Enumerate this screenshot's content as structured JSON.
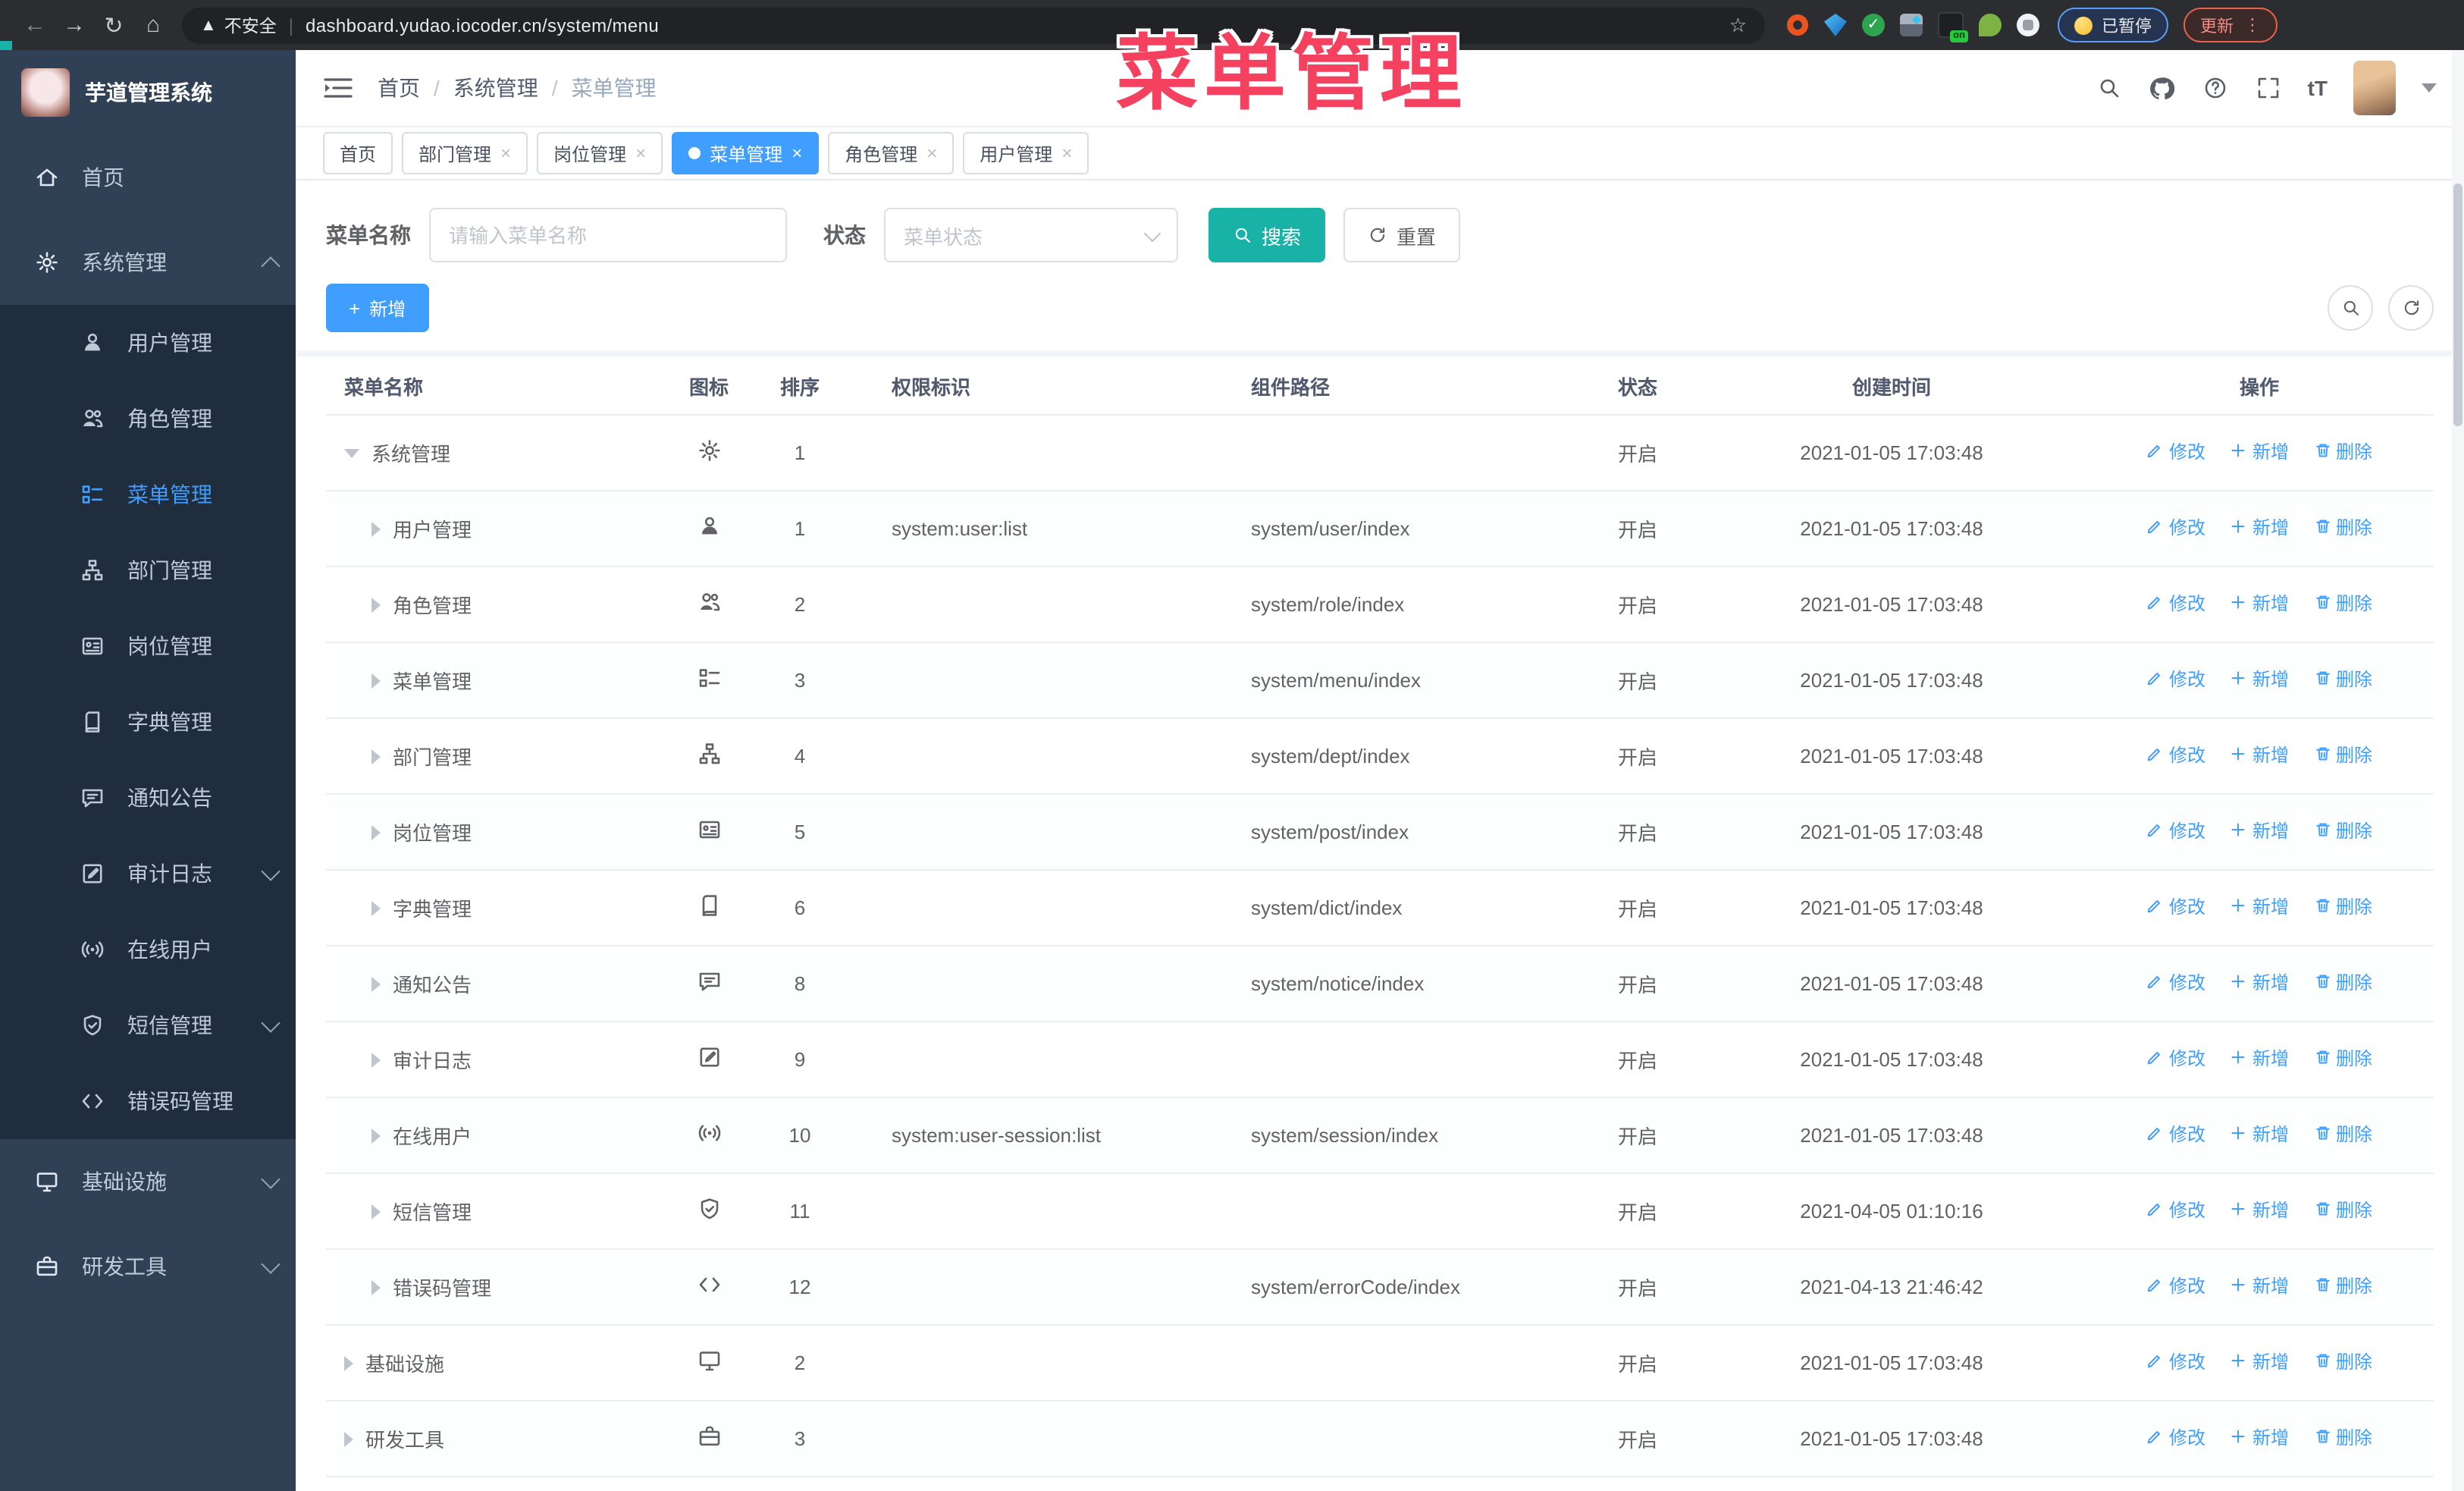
{
  "overlay_title": "菜单管理",
  "colors": {
    "accent": "#409eff",
    "teal": "#18b3a6",
    "pink": "#f4415f",
    "sidebar_bg": "#304156",
    "submenu_bg": "#1f2d3d"
  },
  "browser": {
    "security_label": "不安全",
    "url": "dashboard.yudao.iocoder.cn/system/menu",
    "paused_badge": "已暂停",
    "update_button": "更新",
    "extensions": [
      {
        "icon": "ubuntu-ring"
      },
      {
        "icon": "blue-gem"
      },
      {
        "icon": "green-check"
      },
      {
        "icon": "grid-widget"
      },
      {
        "icon": "monitor-ext",
        "badge": "on"
      },
      {
        "icon": "leaf-ext"
      },
      {
        "icon": "puzzle-ext"
      }
    ]
  },
  "sidebar": {
    "logo_title": "芋道管理系统",
    "entries": [
      {
        "id": "home",
        "label": "首页",
        "icon": "home",
        "type": "root"
      },
      {
        "id": "system",
        "label": "系统管理",
        "icon": "gear",
        "type": "root",
        "arrow": "up"
      },
      {
        "id": "user",
        "label": "用户管理",
        "icon": "user",
        "type": "sub"
      },
      {
        "id": "role",
        "label": "角色管理",
        "icon": "users",
        "type": "sub"
      },
      {
        "id": "menu",
        "label": "菜单管理",
        "icon": "menu",
        "type": "sub",
        "active": true
      },
      {
        "id": "dept",
        "label": "部门管理",
        "icon": "tree",
        "type": "sub"
      },
      {
        "id": "post",
        "label": "岗位管理",
        "icon": "postcard",
        "type": "sub"
      },
      {
        "id": "dict",
        "label": "字典管理",
        "icon": "dict",
        "type": "sub"
      },
      {
        "id": "notice",
        "label": "通知公告",
        "icon": "notice",
        "type": "sub"
      },
      {
        "id": "audit",
        "label": "审计日志",
        "icon": "audit",
        "type": "sub",
        "arrow": "down"
      },
      {
        "id": "online",
        "label": "在线用户",
        "icon": "online",
        "type": "sub"
      },
      {
        "id": "sms",
        "label": "短信管理",
        "icon": "sms",
        "type": "sub",
        "arrow": "down"
      },
      {
        "id": "errorcode",
        "label": "错误码管理",
        "icon": "code",
        "type": "sub"
      },
      {
        "id": "infra",
        "label": "基础设施",
        "icon": "infra",
        "type": "root",
        "arrow": "down"
      },
      {
        "id": "devtool",
        "label": "研发工具",
        "icon": "tool",
        "type": "root",
        "arrow": "down"
      }
    ]
  },
  "header": {
    "breadcrumb": [
      "首页",
      "系统管理",
      "菜单管理"
    ]
  },
  "tabs": [
    {
      "label": "首页"
    },
    {
      "label": "部门管理",
      "closable": true
    },
    {
      "label": "岗位管理",
      "closable": true
    },
    {
      "label": "菜单管理",
      "closable": true,
      "active": true
    },
    {
      "label": "角色管理",
      "closable": true
    },
    {
      "label": "用户管理",
      "closable": true
    }
  ],
  "search": {
    "name_label": "菜单名称",
    "name_placeholder": "请输入菜单名称",
    "status_label": "状态",
    "status_placeholder": "菜单状态",
    "search_button": "搜索",
    "reset_button": "重置"
  },
  "toolbar": {
    "add_button": "新增"
  },
  "table": {
    "columns": [
      "菜单名称",
      "图标",
      "排序",
      "权限标识",
      "组件路径",
      "状态",
      "创建时间",
      "操作"
    ],
    "action_labels": {
      "edit": "修改",
      "add": "新增",
      "del": "删除"
    },
    "rows": [
      {
        "level": 0,
        "caret": "down",
        "name": "系统管理",
        "icon": "gear",
        "sort": "1",
        "perm": "",
        "path": "",
        "status": "开启",
        "time": "2021-01-05 17:03:48"
      },
      {
        "level": 1,
        "caret": "right",
        "name": "用户管理",
        "icon": "user",
        "sort": "1",
        "perm": "system:user:list",
        "path": "system/user/index",
        "status": "开启",
        "time": "2021-01-05 17:03:48"
      },
      {
        "level": 1,
        "caret": "right",
        "name": "角色管理",
        "icon": "users",
        "sort": "2",
        "perm": "",
        "path": "system/role/index",
        "status": "开启",
        "time": "2021-01-05 17:03:48"
      },
      {
        "level": 1,
        "caret": "right",
        "name": "菜单管理",
        "icon": "menu",
        "sort": "3",
        "perm": "",
        "path": "system/menu/index",
        "status": "开启",
        "time": "2021-01-05 17:03:48"
      },
      {
        "level": 1,
        "caret": "right",
        "name": "部门管理",
        "icon": "tree",
        "sort": "4",
        "perm": "",
        "path": "system/dept/index",
        "status": "开启",
        "time": "2021-01-05 17:03:48"
      },
      {
        "level": 1,
        "caret": "right",
        "name": "岗位管理",
        "icon": "postcard",
        "sort": "5",
        "perm": "",
        "path": "system/post/index",
        "status": "开启",
        "time": "2021-01-05 17:03:48"
      },
      {
        "level": 1,
        "caret": "right",
        "name": "字典管理",
        "icon": "dict",
        "sort": "6",
        "perm": "",
        "path": "system/dict/index",
        "status": "开启",
        "time": "2021-01-05 17:03:48"
      },
      {
        "level": 1,
        "caret": "right",
        "name": "通知公告",
        "icon": "notice",
        "sort": "8",
        "perm": "",
        "path": "system/notice/index",
        "status": "开启",
        "time": "2021-01-05 17:03:48"
      },
      {
        "level": 1,
        "caret": "right",
        "name": "审计日志",
        "icon": "audit",
        "sort": "9",
        "perm": "",
        "path": "",
        "status": "开启",
        "time": "2021-01-05 17:03:48"
      },
      {
        "level": 1,
        "caret": "right",
        "name": "在线用户",
        "icon": "online",
        "sort": "10",
        "perm": "system:user-session:list",
        "path": "system/session/index",
        "status": "开启",
        "time": "2021-01-05 17:03:48"
      },
      {
        "level": 1,
        "caret": "right",
        "name": "短信管理",
        "icon": "sms",
        "sort": "11",
        "perm": "",
        "path": "",
        "status": "开启",
        "time": "2021-04-05 01:10:16"
      },
      {
        "level": 1,
        "caret": "right",
        "name": "错误码管理",
        "icon": "code",
        "sort": "12",
        "perm": "",
        "path": "system/errorCode/index",
        "status": "开启",
        "time": "2021-04-13 21:46:42"
      },
      {
        "level": 0,
        "caret": "right",
        "name": "基础设施",
        "icon": "infra",
        "sort": "2",
        "perm": "",
        "path": "",
        "status": "开启",
        "time": "2021-01-05 17:03:48"
      },
      {
        "level": 0,
        "caret": "right",
        "name": "研发工具",
        "icon": "tool",
        "sort": "3",
        "perm": "",
        "path": "",
        "status": "开启",
        "time": "2021-01-05 17:03:48"
      }
    ]
  }
}
